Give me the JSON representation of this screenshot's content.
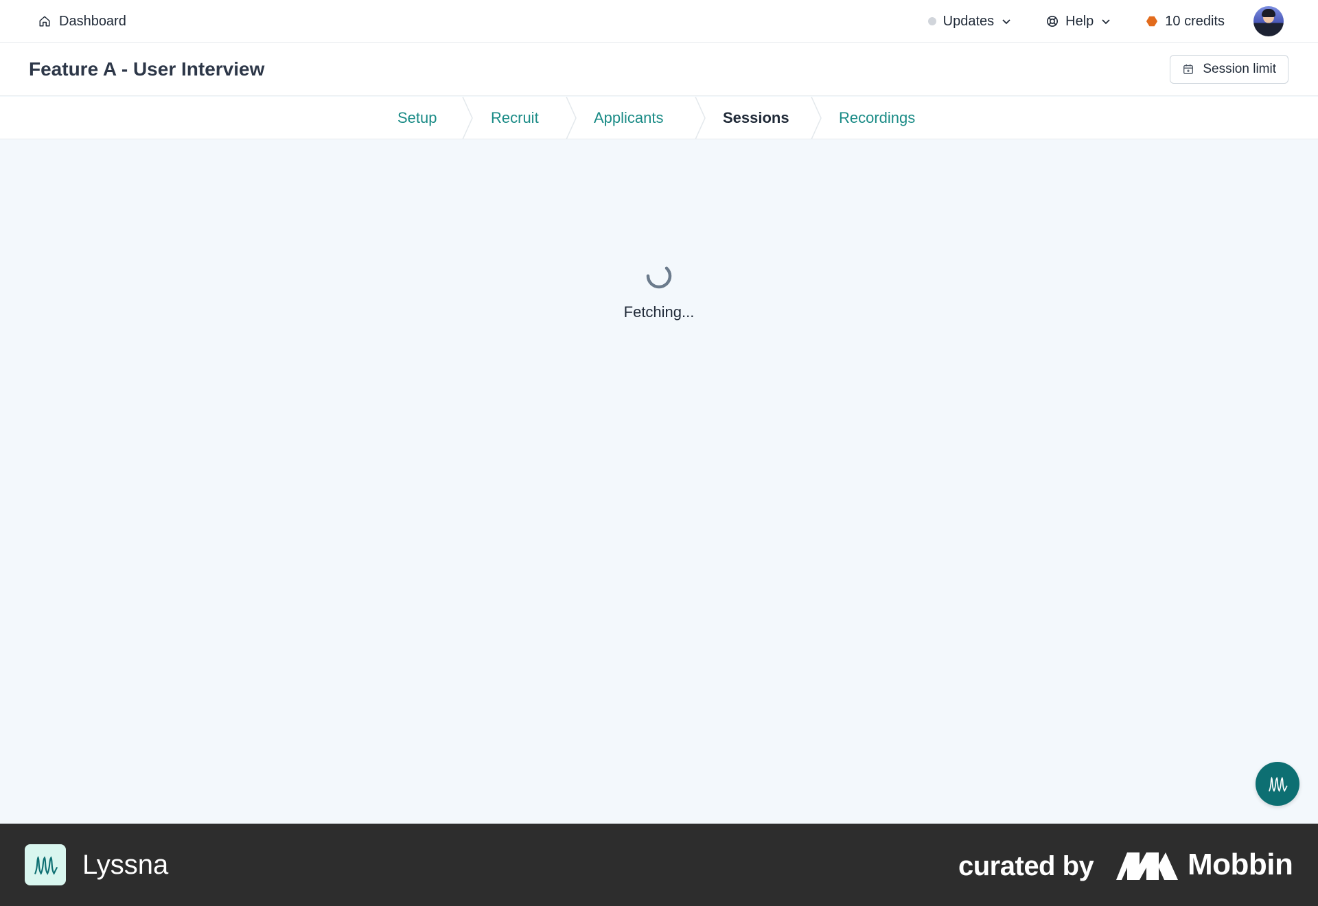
{
  "topbar": {
    "dashboard_label": "Dashboard",
    "updates_label": "Updates",
    "help_label": "Help",
    "credits_label": "10 credits"
  },
  "header": {
    "title": "Feature A - User Interview",
    "session_limit_label": "Session limit"
  },
  "steps": [
    {
      "label": "Setup",
      "active": false
    },
    {
      "label": "Recruit",
      "active": false
    },
    {
      "label": "Applicants",
      "active": false
    },
    {
      "label": "Sessions",
      "active": true
    },
    {
      "label": "Recordings",
      "active": false
    }
  ],
  "main": {
    "loading_text": "Fetching..."
  },
  "footer": {
    "brand_name": "Lyssna",
    "curated_by": "curated by",
    "curator_name": "Mobbin"
  },
  "colors": {
    "accent": "#1a8b86",
    "fab": "#0d6f72",
    "credit_dot": "#e26b1c",
    "footer_bg": "#2d2d2d"
  }
}
